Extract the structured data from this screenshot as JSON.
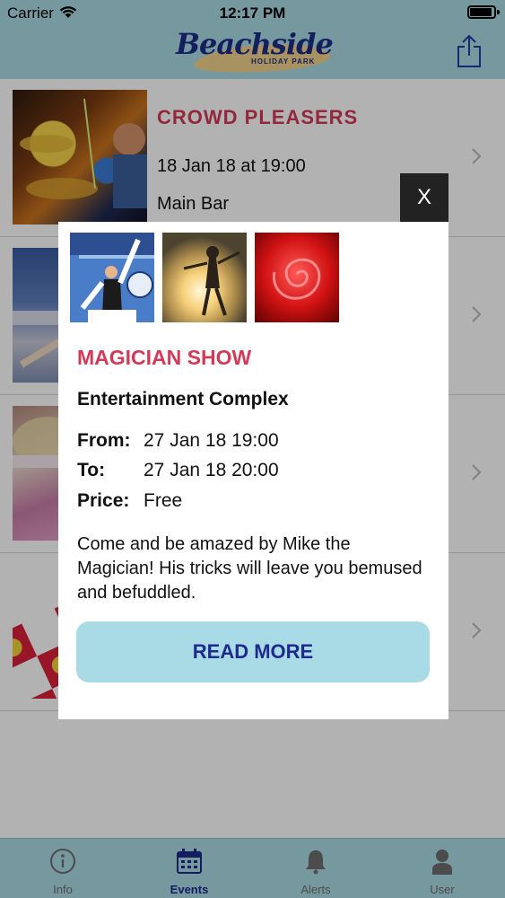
{
  "status_bar": {
    "carrier": "Carrier",
    "time": "12:17 PM"
  },
  "header": {
    "logo_main": "Beachside",
    "logo_sub": "HOLIDAY PARK",
    "share_icon": "share-icon"
  },
  "list": {
    "rows": [
      {
        "title": "CROWD PLEASERS",
        "date": "18 Jan 18 at 19:00",
        "venue": "Main Bar"
      }
    ]
  },
  "modal": {
    "close_label": "X",
    "title": "MAGICIAN SHOW",
    "venue": "Entertainment Complex",
    "from_label": "From:",
    "from_value": "27 Jan 18 19:00",
    "to_label": "To:",
    "to_value": "27 Jan 18 20:00",
    "price_label": "Price:",
    "price_value": "Free",
    "description": "Come and be amazed by Mike the Magician! His tricks will leave you bemused and befuddled.",
    "button_label": "READ MORE"
  },
  "tabbar": {
    "tabs": [
      {
        "label": "Info",
        "icon": "info-icon",
        "active": false
      },
      {
        "label": "Events",
        "icon": "calendar-icon",
        "active": true
      },
      {
        "label": "Alerts",
        "icon": "bell-icon",
        "active": false
      },
      {
        "label": "User",
        "icon": "user-icon",
        "active": false
      }
    ]
  },
  "colors": {
    "accent": "#d33a58",
    "brand": "#1e2f86",
    "bar": "#a9dbe6"
  }
}
